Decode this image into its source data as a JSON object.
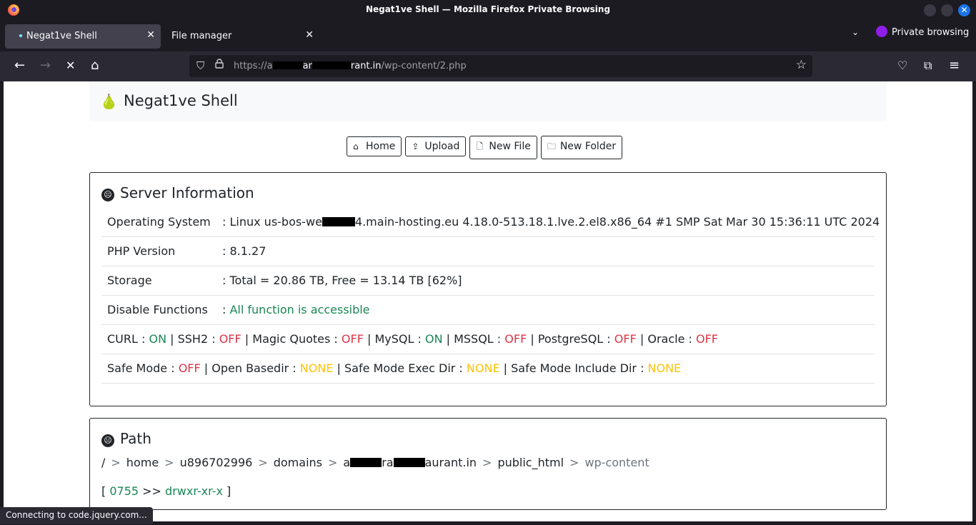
{
  "window": {
    "title": "Negat1ve Shell — Mozilla Firefox Private Browsing",
    "close_glyph": "✕"
  },
  "tabs": [
    {
      "label": "Negat1ve Shell",
      "active": true
    },
    {
      "label": "File manager",
      "active": false
    }
  ],
  "private_label": "Private browsing",
  "nav": {
    "url_prefix": "https://a",
    "url_mid": "ar",
    "url_host_end": "rant.in",
    "url_path": "/wp-content/2.php"
  },
  "brand": {
    "name": "Negat1ve Shell",
    "logo": "🍐"
  },
  "toolbar": {
    "home": "Home",
    "upload": "Upload",
    "new_file": "New File",
    "new_folder": "New Folder"
  },
  "server_info": {
    "title": "Server Information",
    "os_key": "Operating System",
    "os_val_a": ": Linux us-bos-we",
    "os_val_b": "4.main-hosting.eu 4.18.0-513.18.1.lve.2.el8.x86_64 #1 SMP Sat Mar 30 15:36:11 UTC 2024",
    "php_key": "PHP Version",
    "php_val": ": 8.1.27",
    "storage_key": "Storage",
    "storage_val": ": Total = 20.86 TB, Free = 13.14 TB [62%]",
    "disable_key": "Disable Functions",
    "disable_sep": ": ",
    "disable_val": "All function is accessible",
    "curl_label": "CURL : ",
    "curl_val": "ON",
    "ssh2_label": " | SSH2 : ",
    "ssh2_val": "OFF",
    "magic_label": " | Magic Quotes : ",
    "magic_val": "OFF",
    "mysql_label": " | MySQL : ",
    "mysql_val": "ON",
    "mssql_label": " | MSSQL : ",
    "mssql_val": "OFF",
    "pg_label": " | PostgreSQL : ",
    "pg_val": "OFF",
    "oracle_label": " | Oracle : ",
    "oracle_val": "OFF",
    "safe_label": "Safe Mode : ",
    "safe_val": "OFF",
    "basedir_label": " | Open Basedir : ",
    "basedir_val": "NONE",
    "exec_label": " | Safe Mode Exec Dir : ",
    "exec_val": "NONE",
    "include_label": " | Safe Mode Include Dir : ",
    "include_val": "NONE"
  },
  "path": {
    "title": "Path",
    "root": "/",
    "sep": ">",
    "home": "home",
    "user": "u896702996",
    "domains": "domains",
    "domain_a": "a",
    "domain_b": "ra",
    "domain_c": "aurant.in",
    "public_html": "public_html",
    "current": "wp-content",
    "perm_open": "[ ",
    "perm_octal": "0755",
    "perm_arrow": " >> ",
    "perm_str": "drwxr-xr-x",
    "perm_close": " ]"
  },
  "status": "Connecting to code.jquery.com..."
}
